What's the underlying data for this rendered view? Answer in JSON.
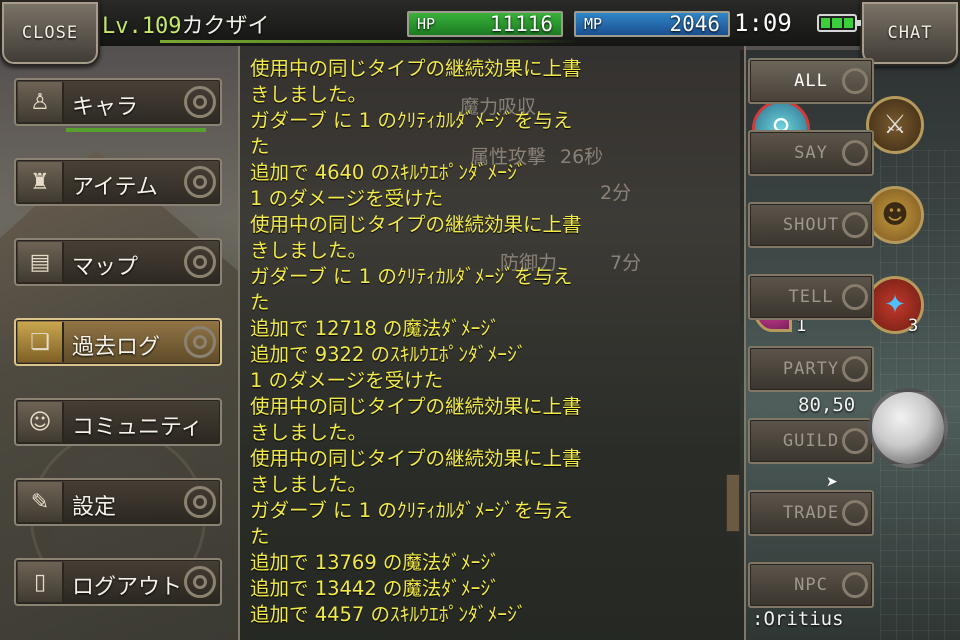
{
  "topbar": {
    "close_label": "CLOSE",
    "chat_label": "CHAT",
    "level": "Lv.109",
    "character_name": "カクザイ",
    "hp_label": "HP",
    "hp_value": "11116",
    "mp_label": "MP",
    "mp_value": "2046",
    "clock": "1:09",
    "battery_icon": "battery-icon"
  },
  "menu": {
    "items": [
      {
        "label": "キャラ",
        "icon": "character-icon"
      },
      {
        "label": "アイテム",
        "icon": "item-icon"
      },
      {
        "label": "マップ",
        "icon": "map-icon"
      },
      {
        "label": "過去ログ",
        "icon": "book-icon",
        "active": true
      },
      {
        "label": "コミュニティ",
        "icon": "community-icon"
      },
      {
        "label": "設定",
        "icon": "settings-icon"
      },
      {
        "label": "ログアウト",
        "icon": "door-icon"
      }
    ]
  },
  "log": {
    "lines": [
      "使用中の同じタイプの継続効果に上書",
      " きしました。",
      "ガダーブ に 1 のｸﾘﾃｨｶﾙﾀﾞﾒｰｼﾞを与え",
      " た",
      "追加で 4640 のｽｷﾙｳｴﾎﾟﾝﾀﾞﾒｰｼﾞ",
      "1 のダメージを受けた",
      "使用中の同じタイプの継続効果に上書",
      " きしました。",
      "ガダーブ に 1 のｸﾘﾃｨｶﾙﾀﾞﾒｰｼﾞを与え",
      " た",
      "追加で 12718 の魔法ﾀﾞﾒｰｼﾞ",
      "追加で 9322 のｽｷﾙｳｴﾎﾟﾝﾀﾞﾒｰｼﾞ",
      "1 のダメージを受けた",
      "使用中の同じタイプの継続効果に上書",
      " きしました。",
      "使用中の同じタイプの継続効果に上書",
      " きしました。",
      "ガダーブ に 1 のｸﾘﾃｨｶﾙﾀﾞﾒｰｼﾞを与え",
      " た",
      "追加で 13769 の魔法ﾀﾞﾒｰｼﾞ",
      "追加で 13442 の魔法ﾀﾞﾒｰｼﾞ",
      "追加で 4457 のｽｷﾙｳｴﾎﾟﾝﾀﾞﾒｰｼﾞ"
    ],
    "background_text": [
      "魔力吸収",
      "属性攻撃",
      "26秒",
      "2分",
      "防御力",
      "7分"
    ]
  },
  "chat_tabs": [
    "ALL",
    "SAY",
    "SHOUT",
    "TELL",
    "PARTY",
    "GUILD",
    "TRADE",
    "NPC"
  ],
  "skills": {
    "count_1": "1",
    "count_2": "3"
  },
  "coords": "80,50",
  "player_name": ":Oritius",
  "colors": {
    "log_text": "#f1ea4a",
    "hp_bar": "#2fa334",
    "mp_bar": "#2a78bd",
    "level_text": "#c8e86a"
  }
}
